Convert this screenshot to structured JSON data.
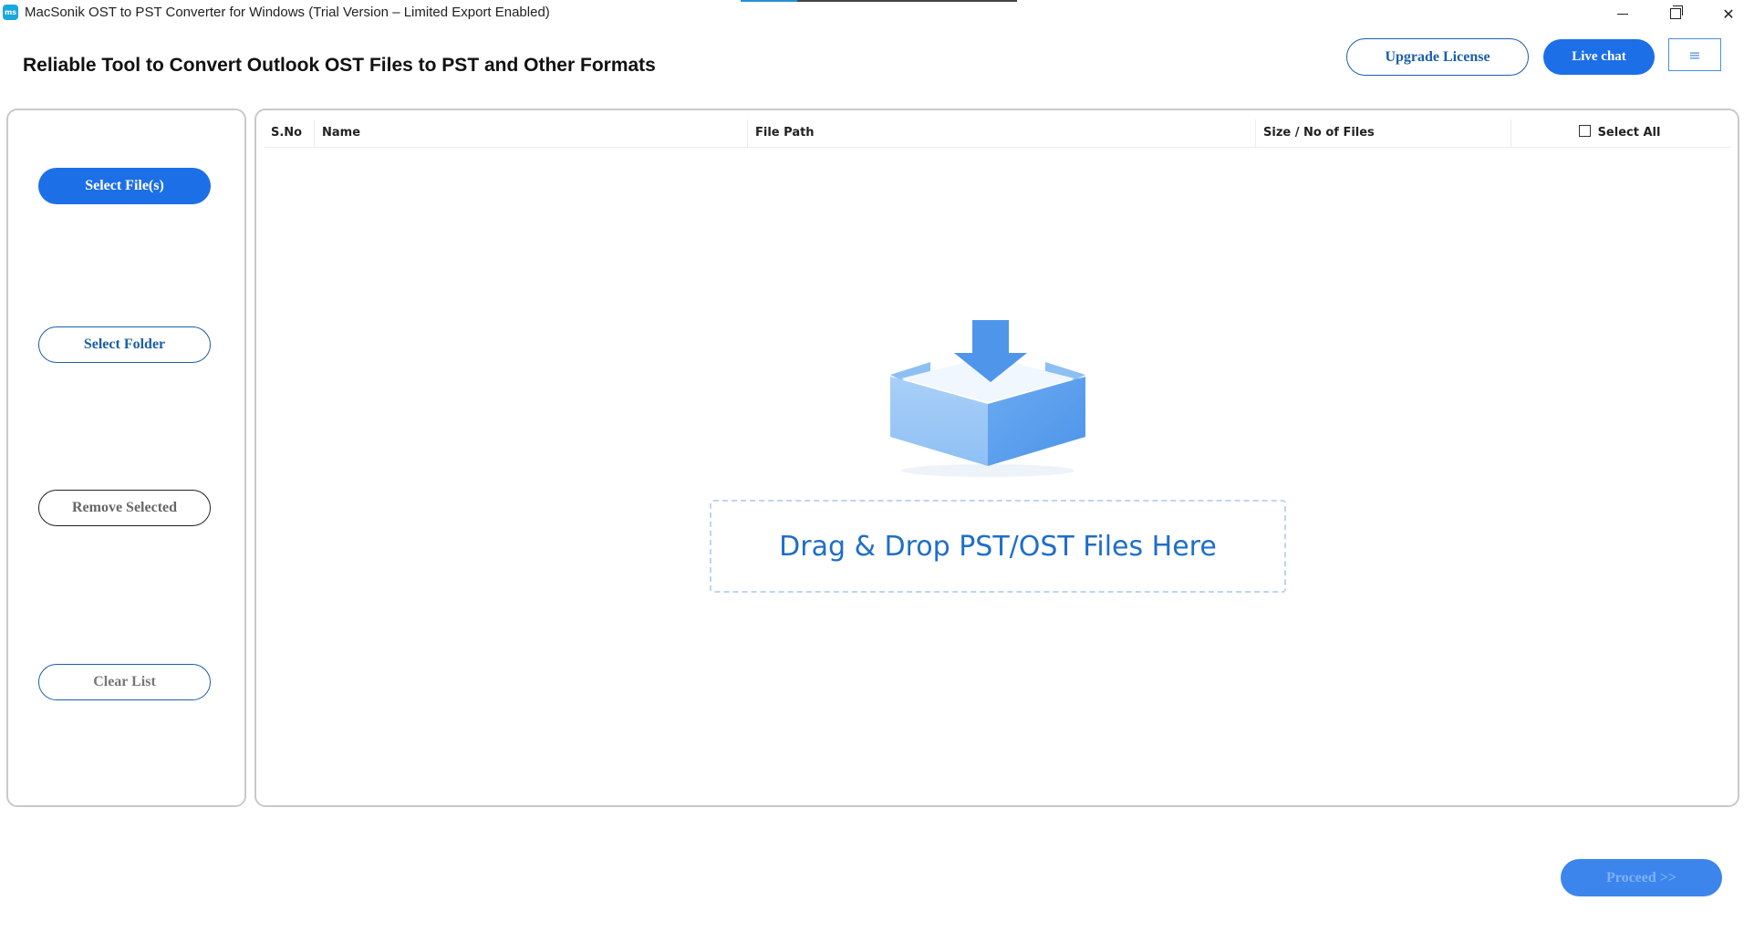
{
  "window": {
    "logo_text": "ms",
    "title": "MacSonik OST to PST Converter for Windows (Trial Version – Limited Export Enabled)",
    "minimize_label": "",
    "close_label": "✕"
  },
  "header": {
    "headline": "Reliable Tool to Convert Outlook OST Files to PST and Other Formats",
    "upgrade_label": "Upgrade License",
    "live_chat_label": "Live chat",
    "menu_icon": "≡"
  },
  "sidebar": {
    "select_files_label": "Select File(s)",
    "select_folder_label": "Select Folder",
    "remove_selected_label": "Remove Selected",
    "clear_list_label": "Clear List"
  },
  "table": {
    "columns": {
      "sno": "S.No",
      "name": "Name",
      "file_path": "File Path",
      "size": "Size / No of Files",
      "select_all": "Select All"
    }
  },
  "drop_zone": {
    "icon": "download-box-icon",
    "text": "Drag & Drop PST/OST Files Here"
  },
  "footer": {
    "proceed_label": "Proceed >>"
  },
  "colors": {
    "primary": "#1c6fe6",
    "outline": "#1b5fa8",
    "drop_text": "#1f6ec9",
    "panel_border": "#c9c9c9"
  }
}
